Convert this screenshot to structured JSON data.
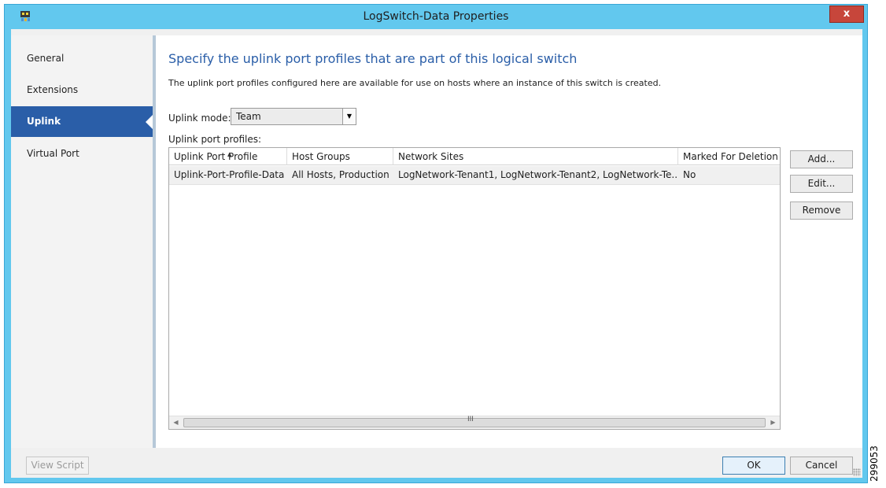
{
  "window": {
    "title": "LogSwitch-Data Properties",
    "close_label": "x"
  },
  "sidebar": {
    "items": [
      {
        "label": "General"
      },
      {
        "label": "Extensions"
      },
      {
        "label": "Uplink"
      },
      {
        "label": "Virtual Port"
      }
    ],
    "active": "Uplink"
  },
  "main": {
    "heading": "Specify the uplink port profiles that are part of this logical switch",
    "description": "The uplink port profiles configured here are available for use on hosts where an instance of this switch is created.",
    "uplink_mode_label": "Uplink mode:",
    "uplink_mode_value": "Team",
    "profiles_label": "Uplink port profiles:",
    "table": {
      "columns": [
        "Uplink Port Profile",
        "Host Groups",
        "Network Sites",
        "Marked For Deletion"
      ],
      "rows": [
        [
          "Uplink-Port-Profile-Data",
          "All Hosts, Production",
          "LogNetwork-Tenant1, LogNetwork-Tenant2, LogNetwork-Te...",
          "No"
        ]
      ],
      "scroll_grip": "III"
    },
    "buttons": {
      "add": "Add...",
      "edit": "Edit...",
      "remove": "Remove"
    }
  },
  "footer": {
    "view_script": "View Script",
    "ok": "OK",
    "cancel": "Cancel"
  },
  "figure_number": "299053",
  "colors": {
    "window_frame": "#62c8ee",
    "accent": "#2a5ea8",
    "close": "#c7463b"
  }
}
